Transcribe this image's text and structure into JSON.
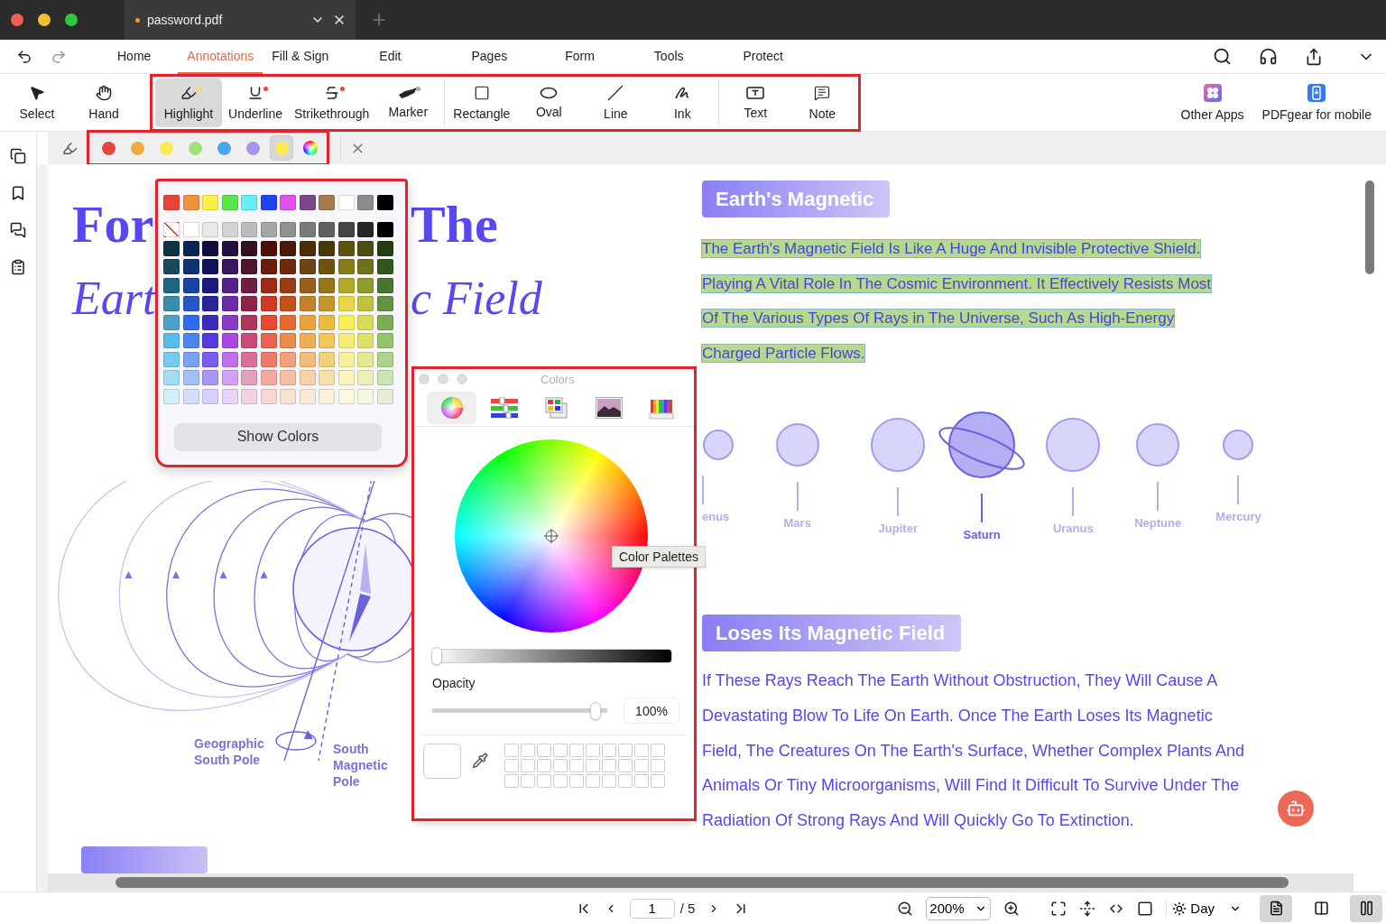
{
  "window": {
    "tab_title": "password.pdf",
    "unsaved": true
  },
  "menu": [
    {
      "label": "Home",
      "selected": false
    },
    {
      "label": "Annotations",
      "selected": true
    },
    {
      "label": "Fill & Sign",
      "selected": false
    },
    {
      "label": "Edit",
      "selected": false
    },
    {
      "label": "Pages",
      "selected": false
    },
    {
      "label": "Form",
      "selected": false
    },
    {
      "label": "Tools",
      "selected": false
    },
    {
      "label": "Protect",
      "selected": false
    }
  ],
  "toolbar": {
    "basic": [
      {
        "kind": "select",
        "label": "Select",
        "selected": false
      },
      {
        "kind": "hand",
        "label": "Hand",
        "selected": false
      }
    ],
    "markup_groups": [
      [
        {
          "kind": "highlight",
          "label": "Highlight",
          "selected": true,
          "color": "#f5e050"
        },
        {
          "kind": "underline",
          "label": "Underline",
          "selected": false,
          "color": "#e8453c"
        },
        {
          "kind": "strikethrough",
          "label": "Strikethrough",
          "selected": false,
          "color": "#e8453c"
        },
        {
          "kind": "marker",
          "label": "Marker",
          "selected": false,
          "color": "#a8a8a8"
        }
      ],
      [
        {
          "kind": "rectangle",
          "label": "Rectangle",
          "selected": false
        },
        {
          "kind": "oval",
          "label": "Oval",
          "selected": false
        },
        {
          "kind": "line",
          "label": "Line",
          "selected": false
        },
        {
          "kind": "ink",
          "label": "Ink",
          "selected": false
        }
      ],
      [
        {
          "kind": "text",
          "label": "Text",
          "selected": false
        },
        {
          "kind": "note",
          "label": "Note",
          "selected": false
        }
      ]
    ],
    "apps": [
      {
        "kind": "apps",
        "label": "Other Apps"
      },
      {
        "kind": "mobile",
        "label": "PDFgear for mobile"
      }
    ]
  },
  "color_bar": {
    "swatches": [
      {
        "color": "#e8453c",
        "selected": false
      },
      {
        "color": "#f2aa3a",
        "selected": false
      },
      {
        "color": "#f8ec4c",
        "selected": false
      },
      {
        "color": "#9ee27a",
        "selected": false
      },
      {
        "color": "#4aa6f0",
        "selected": false
      },
      {
        "color": "#a594ea",
        "selected": false
      },
      {
        "color": "#f8ec4c",
        "selected": true
      }
    ]
  },
  "palette": {
    "rows": [
      [
        {
          "color": "#e94436"
        },
        {
          "color": "#f0923a"
        },
        {
          "color": "#fbf04b"
        },
        {
          "color": "#5ae64a"
        },
        {
          "color": "#66f0f4"
        },
        {
          "color": "#1d44f0"
        },
        {
          "color": "#e052ec"
        },
        {
          "color": "#7a4888"
        },
        {
          "color": "#a47c50"
        },
        {
          "color": "#ffffff"
        },
        {
          "color": "#8c8c8c"
        },
        {
          "color": "#000000"
        }
      ],
      [
        {
          "kind": "none"
        },
        {
          "color": "#ffffff"
        },
        {
          "color": "#e8e8e8"
        },
        {
          "color": "#d4d4d4"
        },
        {
          "color": "#bcbcbc"
        },
        {
          "color": "#a6a6a6"
        },
        {
          "color": "#909090"
        },
        {
          "color": "#7a7a7a"
        },
        {
          "color": "#606060"
        },
        {
          "color": "#444444"
        },
        {
          "color": "#262626"
        },
        {
          "color": "#000000"
        }
      ],
      [
        {
          "color": "#0f3440"
        },
        {
          "color": "#0a2456"
        },
        {
          "color": "#0f0d3f"
        },
        {
          "color": "#23103f"
        },
        {
          "color": "#331020"
        },
        {
          "color": "#4d0f06"
        },
        {
          "color": "#4a1a08"
        },
        {
          "color": "#4a2e08"
        },
        {
          "color": "#4a3808"
        },
        {
          "color": "#5c5410"
        },
        {
          "color": "#4a4e12"
        },
        {
          "color": "#243d14"
        }
      ],
      [
        {
          "color": "#184a5c"
        },
        {
          "color": "#0e3276"
        },
        {
          "color": "#14125e"
        },
        {
          "color": "#3a1560"
        },
        {
          "color": "#4d1530"
        },
        {
          "color": "#701a0e"
        },
        {
          "color": "#6e2a0c"
        },
        {
          "color": "#6e4410"
        },
        {
          "color": "#6e520e"
        },
        {
          "color": "#867c18"
        },
        {
          "color": "#6e7218"
        },
        {
          "color": "#325620"
        }
      ],
      [
        {
          "color": "#1e6680"
        },
        {
          "color": "#1844a8"
        },
        {
          "color": "#1c1a80"
        },
        {
          "color": "#54208a"
        },
        {
          "color": "#6e1e40"
        },
        {
          "color": "#a02a18"
        },
        {
          "color": "#9a3c14"
        },
        {
          "color": "#986018"
        },
        {
          "color": "#9a7418"
        },
        {
          "color": "#b4a82a"
        },
        {
          "color": "#929a2a"
        },
        {
          "color": "#4a7430"
        }
      ],
      [
        {
          "color": "#3a8aaa"
        },
        {
          "color": "#2458c8"
        },
        {
          "color": "#2a2498"
        },
        {
          "color": "#6a2ca4"
        },
        {
          "color": "#8e2448"
        },
        {
          "color": "#cc3a22"
        },
        {
          "color": "#c4501a"
        },
        {
          "color": "#c4802a"
        },
        {
          "color": "#c4962c"
        },
        {
          "color": "#e8d844"
        },
        {
          "color": "#c0c23c"
        },
        {
          "color": "#649440"
        }
      ],
      [
        {
          "color": "#4aa2c8"
        },
        {
          "color": "#2e6af5"
        },
        {
          "color": "#3c2ab8"
        },
        {
          "color": "#8a3ac4"
        },
        {
          "color": "#b0345c"
        },
        {
          "color": "#e84a30"
        },
        {
          "color": "#e86a2a"
        },
        {
          "color": "#eca23a"
        },
        {
          "color": "#ecba3c"
        },
        {
          "color": "#f8f050"
        },
        {
          "color": "#d8dc50"
        },
        {
          "color": "#7cae50"
        }
      ],
      [
        {
          "color": "#56bcec"
        },
        {
          "color": "#4a86ee"
        },
        {
          "color": "#5a3ae0"
        },
        {
          "color": "#a84ae0"
        },
        {
          "color": "#cc4a7a"
        },
        {
          "color": "#ec6450"
        },
        {
          "color": "#ee8a4c"
        },
        {
          "color": "#f0ae50"
        },
        {
          "color": "#f2c658"
        },
        {
          "color": "#f6ee74"
        },
        {
          "color": "#dce06a"
        },
        {
          "color": "#92c46a"
        }
      ],
      [
        {
          "color": "#74ccf0"
        },
        {
          "color": "#78a2f2"
        },
        {
          "color": "#7c5cf0"
        },
        {
          "color": "#c070ec"
        },
        {
          "color": "#d8709a"
        },
        {
          "color": "#ee7a68"
        },
        {
          "color": "#f0a07a"
        },
        {
          "color": "#f2bc78"
        },
        {
          "color": "#f4d07a"
        },
        {
          "color": "#f8f09a"
        },
        {
          "color": "#e6e890"
        },
        {
          "color": "#aed48a"
        }
      ],
      [
        {
          "color": "#a4dcf4"
        },
        {
          "color": "#a4bef6"
        },
        {
          "color": "#a898f4"
        },
        {
          "color": "#d4a0f2"
        },
        {
          "color": "#e4a0bc"
        },
        {
          "color": "#f2aaa0"
        },
        {
          "color": "#f4c0a4"
        },
        {
          "color": "#f6d2a8"
        },
        {
          "color": "#f8e0ac"
        },
        {
          "color": "#faf4c0"
        },
        {
          "color": "#eef0b8"
        },
        {
          "color": "#cce4b4"
        }
      ],
      [
        {
          "color": "#d4eefa"
        },
        {
          "color": "#d4e0fa"
        },
        {
          "color": "#d8d0fa"
        },
        {
          "color": "#ecd2f8"
        },
        {
          "color": "#f2d2e0"
        },
        {
          "color": "#f8d8d4"
        },
        {
          "color": "#f8e2d4"
        },
        {
          "color": "#faebd6"
        },
        {
          "color": "#fcf0d8"
        },
        {
          "color": "#fcf8e2"
        },
        {
          "color": "#f6f8e0"
        },
        {
          "color": "#e2eed8"
        }
      ]
    ],
    "button": "Show Colors"
  },
  "colors_panel": {
    "title": "Colors",
    "modes": [
      {
        "kind": "wheel",
        "selected": true
      },
      {
        "kind": "sliders",
        "selected": false
      },
      {
        "kind": "palettes",
        "selected": false
      },
      {
        "kind": "image",
        "selected": false
      },
      {
        "kind": "pencils",
        "selected": false
      }
    ],
    "tooltip": "Color Palettes",
    "brightness": {
      "level": 0
    },
    "opacity": {
      "label": "Opacity",
      "level": 0.96,
      "value": "100%"
    }
  },
  "document": {
    "title_line_1": [
      "For",
      "The"
    ],
    "title_line_2": [
      "Eart",
      "c Field"
    ],
    "diagram_labels": [
      "Geographic South Pole",
      "South Magnetic Pole"
    ],
    "heading_1": "Earth's Magnetic",
    "highlighted_lines": [
      "The Earth's Magnetic Field Is Like A Huge And Invisible Protective Shield.",
      "Playing A Vital Role In The Cosmic Environment. It Effectively Resists Most",
      "Of The Various Types Of Rays in The Universe, Such As High-Energy",
      "Charged Particle Flows."
    ],
    "planets": [
      {
        "name": "enus",
        "selected": false
      },
      {
        "name": "Mars",
        "selected": false
      },
      {
        "name": "Jupiter",
        "selected": false
      },
      {
        "name": "Saturn",
        "selected": true
      },
      {
        "name": "Uranus",
        "selected": false
      },
      {
        "name": "Neptune",
        "selected": false
      },
      {
        "name": "Mercury",
        "selected": false
      }
    ],
    "heading_2": "Loses Its Magnetic Field",
    "paragraph_lines": [
      "If These Rays Reach The Earth Without Obstruction, They Will Cause A",
      "Devastating Blow To Life On Earth. Once The Earth Loses Its Magnetic",
      "Field, The Creatures On The Earth's Surface, Whether Complex Plants And",
      "Animals Or Tiny Microorganisms, Will Find It Difficult To Survive Under The",
      "Radiation Of Strong Rays And Will Quickly Go To Extinction."
    ]
  },
  "status_bar": {
    "page": "1",
    "page_count": "/ 5",
    "zoom": "200%",
    "theme": "Day",
    "views": [
      {
        "kind": "single",
        "selected": true
      },
      {
        "kind": "double",
        "selected": false
      },
      {
        "kind": "scroll",
        "selected": true
      }
    ]
  }
}
